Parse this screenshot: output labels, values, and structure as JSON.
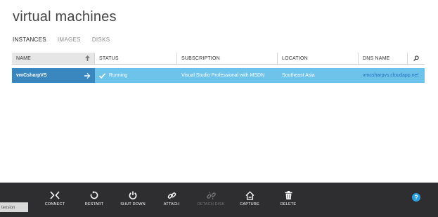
{
  "page": {
    "title": "virtual machines"
  },
  "tabs": [
    {
      "label": "INSTANCES",
      "active": true
    },
    {
      "label": "IMAGES",
      "active": false
    },
    {
      "label": "DISKS",
      "active": false
    }
  ],
  "grid": {
    "columns": [
      "NAME",
      "STATUS",
      "SUBSCRIPTION",
      "LOCATION",
      "DNS NAME"
    ],
    "sort_icon": "arrow-up-icon",
    "search_icon": "search-icon",
    "rows": [
      {
        "name": "vmCsharpVS",
        "status": "Running",
        "subscription": "Visual Studio Professional with MSDN",
        "location": "Southeast Asia",
        "dns_name": "vmcsharpvs.cloudapp.net"
      }
    ]
  },
  "commands": [
    {
      "label": "CONNECT",
      "icon": "connect-icon",
      "enabled": true
    },
    {
      "label": "RESTART",
      "icon": "restart-icon",
      "enabled": true
    },
    {
      "label": "SHUT DOWN",
      "icon": "power-icon",
      "enabled": true
    },
    {
      "label": "ATTACH",
      "icon": "link-icon",
      "enabled": true
    },
    {
      "label": "DETACH DISK",
      "icon": "unlink-icon",
      "enabled": false
    },
    {
      "label": "CAPTURE",
      "icon": "home-icon",
      "enabled": true
    },
    {
      "label": "DELETE",
      "icon": "trash-icon",
      "enabled": true
    }
  ],
  "help": {
    "label": "?"
  },
  "extension_tab": {
    "label": "tension"
  },
  "colors": {
    "selected_name_bg": "#3a86be",
    "selected_row_bg": "#6ec3eb",
    "command_bar_bg": "#2e2e31",
    "help_bg": "#2a9fe0"
  }
}
